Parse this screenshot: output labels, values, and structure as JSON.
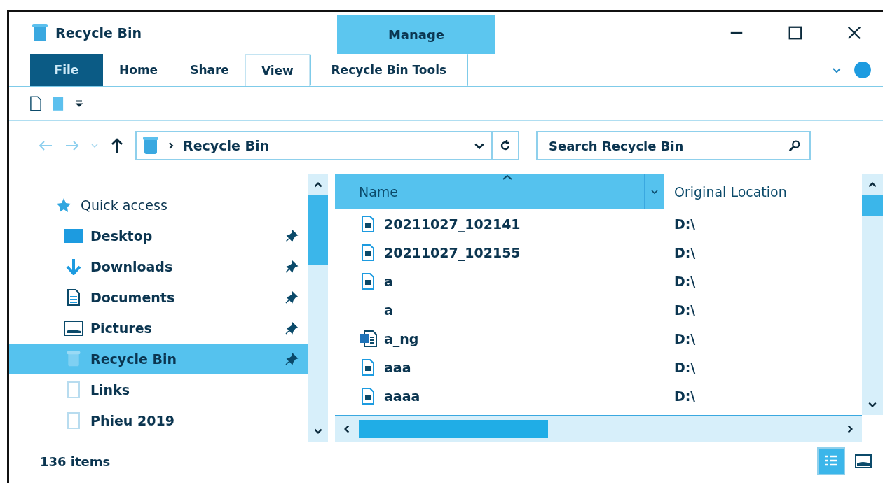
{
  "window": {
    "title": "Recycle Bin"
  },
  "ribbon": {
    "context_header": "Manage",
    "tabs": [
      {
        "label": "File",
        "kind": "file",
        "selected": false
      },
      {
        "label": "Home",
        "kind": "tab",
        "selected": false
      },
      {
        "label": "Share",
        "kind": "tab",
        "selected": false
      },
      {
        "label": "View",
        "kind": "tab",
        "selected": true
      },
      {
        "label": "Recycle Bin Tools",
        "kind": "context",
        "selected": false
      }
    ]
  },
  "address_bar": {
    "path": "Recycle Bin"
  },
  "search": {
    "placeholder": "Search Recycle Bin"
  },
  "navigation": {
    "items": [
      {
        "label": "Quick access",
        "kind": "star",
        "selected": false,
        "pinned": false
      },
      {
        "label": "Desktop",
        "kind": "desktop",
        "selected": false,
        "pinned": true
      },
      {
        "label": "Downloads",
        "kind": "downloads",
        "selected": false,
        "pinned": true
      },
      {
        "label": "Documents",
        "kind": "documents",
        "selected": false,
        "pinned": true
      },
      {
        "label": "Pictures",
        "kind": "pictures",
        "selected": false,
        "pinned": true
      },
      {
        "label": "Recycle Bin",
        "kind": "bin",
        "selected": true,
        "pinned": true
      },
      {
        "label": "Links",
        "kind": "folder",
        "selected": false,
        "pinned": false
      },
      {
        "label": "Phieu 2019",
        "kind": "folder",
        "selected": false,
        "pinned": false
      }
    ]
  },
  "file_list": {
    "columns": [
      {
        "label": "Name",
        "selected": true
      },
      {
        "label": "Original Location",
        "selected": false
      }
    ],
    "rows": [
      {
        "name": "20211027_102141",
        "location": "D:\\",
        "kind": "image"
      },
      {
        "name": "20211027_102155",
        "location": "D:\\",
        "kind": "image"
      },
      {
        "name": "a",
        "location": "D:\\",
        "kind": "image"
      },
      {
        "name": "a",
        "location": "D:\\",
        "kind": "none"
      },
      {
        "name": "a_ng",
        "location": "D:\\",
        "kind": "word"
      },
      {
        "name": "aaa",
        "location": "D:\\",
        "kind": "image"
      },
      {
        "name": "aaaa",
        "location": "D:\\",
        "kind": "image"
      }
    ]
  },
  "status_bar": {
    "count": "136 items",
    "views": [
      {
        "kind": "details",
        "selected": true
      },
      {
        "kind": "large",
        "selected": false
      }
    ]
  }
}
